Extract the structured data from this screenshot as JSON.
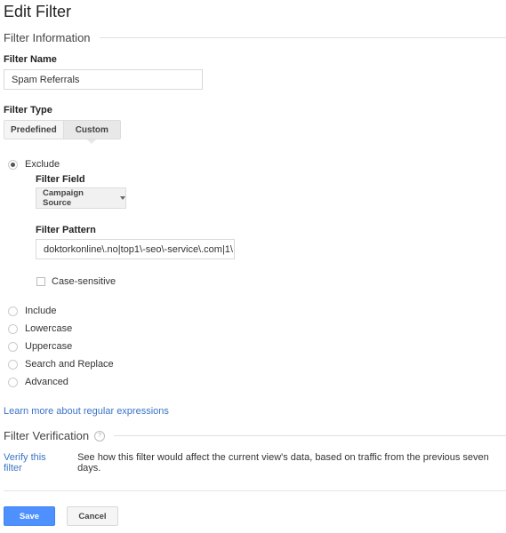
{
  "page": {
    "title": "Edit Filter"
  },
  "filter_information": {
    "section_label": "Filter Information",
    "filter_name_label": "Filter Name",
    "filter_name_value": "Spam Referrals",
    "filter_type_label": "Filter Type",
    "type_tabs": [
      {
        "label": "Predefined",
        "selected": false
      },
      {
        "label": "Custom",
        "selected": true
      }
    ]
  },
  "custom": {
    "options": [
      {
        "label": "Exclude",
        "selected": true
      },
      {
        "label": "Include",
        "selected": false
      },
      {
        "label": "Lowercase",
        "selected": false
      },
      {
        "label": "Uppercase",
        "selected": false
      },
      {
        "label": "Search and Replace",
        "selected": false
      },
      {
        "label": "Advanced",
        "selected": false
      }
    ],
    "filter_field_label": "Filter Field",
    "filter_field_value": "Campaign Source",
    "filter_pattern_label": "Filter Pattern",
    "filter_pattern_value": "doktorkonline\\.no|top1\\-seo\\-service\\.com|1\\",
    "case_sensitive_label": "Case-sensitive",
    "case_sensitive_checked": false
  },
  "learn_more_link": "Learn more about regular expressions",
  "verification": {
    "section_label": "Filter Verification",
    "help_icon": "?",
    "verify_link": "Verify this filter",
    "description": "See how this filter would affect the current view's data, based on traffic from the previous seven days."
  },
  "actions": {
    "save_label": "Save",
    "cancel_label": "Cancel"
  },
  "colors": {
    "primary": "#4d90fe",
    "link": "#3a73c7"
  }
}
